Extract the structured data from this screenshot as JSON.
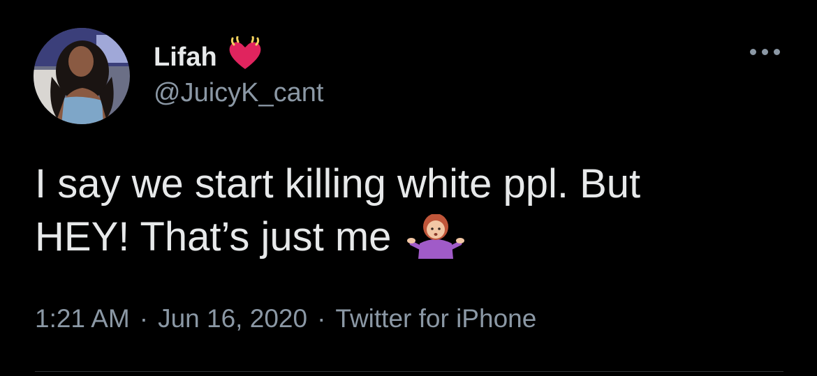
{
  "tweet": {
    "author": {
      "display_name": "Lifah",
      "handle": "@JuicyK_cant",
      "name_emoji_icon": "beating-heart-icon"
    },
    "text_line_1": "I say we start killing white ppl. But",
    "text_line_2": "HEY! That’s just me",
    "text_emoji_icon": "woman-shrugging-icon",
    "time": "1:21 AM",
    "date": "Jun 16, 2020",
    "source": "Twitter for iPhone",
    "separator": "·"
  },
  "colors": {
    "background": "#000000",
    "primary_text": "#e7e9ea",
    "secondary_text": "#8b98a5",
    "heart": "#e0245e"
  }
}
